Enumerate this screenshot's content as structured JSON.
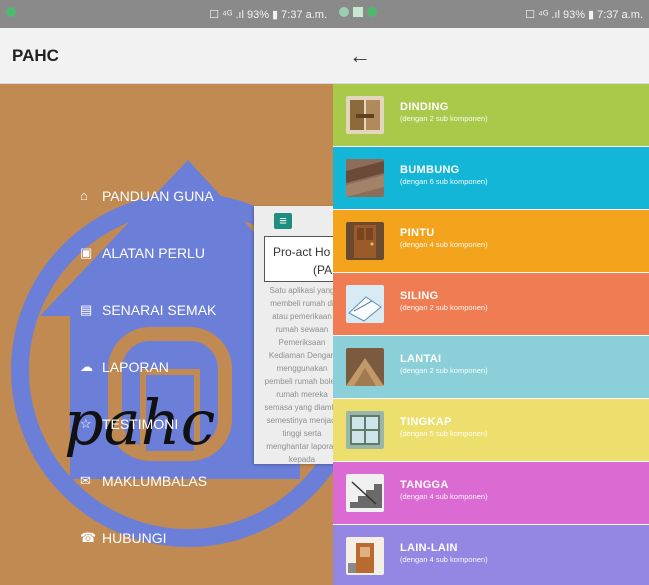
{
  "left_screen": {
    "status": "☐ ⁴ᴳ .ıl 93% ▮ 7:37 a.m.",
    "app_title": "PAHC",
    "menu": [
      {
        "icon": "home-icon",
        "glyph": "⌂",
        "label": "PANDUAN GUNA"
      },
      {
        "icon": "toolbox-icon",
        "glyph": "▣",
        "label": "ALATAN PERLU"
      },
      {
        "icon": "checklist-icon",
        "glyph": "▤",
        "label": "SENARAI SEMAK"
      },
      {
        "icon": "cloud-icon",
        "glyph": "☁",
        "label": "LAPORAN"
      },
      {
        "icon": "star-icon",
        "glyph": "☆",
        "label": "TESTIMONI"
      },
      {
        "icon": "mail-icon",
        "glyph": "✉",
        "label": "MAKLUMBALAS"
      },
      {
        "icon": "phone-icon",
        "glyph": "☎",
        "label": "HUBUNGI"
      }
    ],
    "logo_text": "pahc",
    "popup": {
      "line1": "Pro-act Ho",
      "line2": "(PA",
      "paragraph": "Satu aplikasi yang membeli rumah di atau pemerikaan rumah sewaan Pemeriksaan Kediaman Dengan menggunakan pembeli rumah boleh rumah mereka semasa yang diambil semestinya menjadi tinggi serta menghantar laporan kepada"
    }
  },
  "right_screen": {
    "status": "☐ ⁴ᴳ .ıl 93% ▮ 7:37 a.m.",
    "categories": [
      {
        "name": "DINDING",
        "sub": "(dengan 2 sub komponen)",
        "color": "#a8c94a",
        "icon": "wall-image"
      },
      {
        "name": "BUMBUNG",
        "sub": "(dengan 6 sub komponen)",
        "color": "#13b6d7",
        "icon": "roof-image"
      },
      {
        "name": "PINTU",
        "sub": "(dengan 4 sub komponen)",
        "color": "#f4a41c",
        "icon": "door-image"
      },
      {
        "name": "SILING",
        "sub": "(dengan 2 sub komponen)",
        "color": "#f07c54",
        "icon": "ceiling-image"
      },
      {
        "name": "LANTAI",
        "sub": "(dengan 2 sub komponen)",
        "color": "#8bd0d8",
        "icon": "floor-image"
      },
      {
        "name": "TINGKAP",
        "sub": "(dengan 5 sub komponen)",
        "color": "#ecdf6e",
        "icon": "window-image"
      },
      {
        "name": "TANGGA",
        "sub": "(dengan 4 sub komponen)",
        "color": "#dc6ad3",
        "icon": "stairs-image"
      },
      {
        "name": "LAIN-LAIN",
        "sub": "(dengan 4 sub komponen)",
        "color": "#9387e3",
        "icon": "misc-image"
      }
    ]
  }
}
